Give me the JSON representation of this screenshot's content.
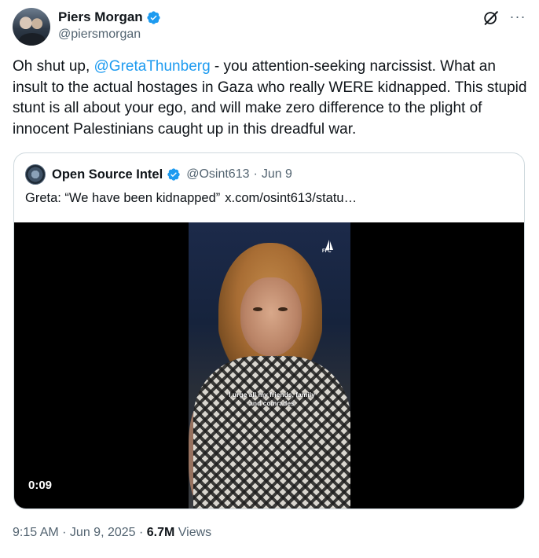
{
  "author": {
    "display_name": "Piers Morgan",
    "handle": "@piersmorgan",
    "verified": true
  },
  "header_icons": [
    "grok-icon",
    "more-icon"
  ],
  "tweet": {
    "text_before": "Oh shut up, ",
    "mention": "@GretaThunberg",
    "text_after": " - you attention-seeking narcissist. What an insult to the actual hostages in Gaza who really WERE kidnapped. This stupid stunt is all about your ego, and will make zero difference to the plight of innocent Palestinians caught up in this dreadful war."
  },
  "quoted_tweet": {
    "display_name": "Open Source Intel",
    "handle": "@Osint613",
    "separator": "·",
    "date": "Jun 9",
    "verified": true,
    "text": "Greta: “We have been kidnapped”",
    "link": "x.com/osint613/statu…",
    "video": {
      "caption": "I urge all my friends, family and comrades",
      "watermark": "FFC",
      "duration": "0:09"
    }
  },
  "meta": {
    "time": "9:15 AM",
    "sep1": " · ",
    "date": "Jun 9, 2025",
    "sep2": " · ",
    "views_count": "6.7M",
    "views_label": " Views"
  },
  "colors": {
    "accent": "#1d9bf0",
    "text": "#0f1419",
    "secondary": "#536471",
    "border": "#cfd9de"
  }
}
